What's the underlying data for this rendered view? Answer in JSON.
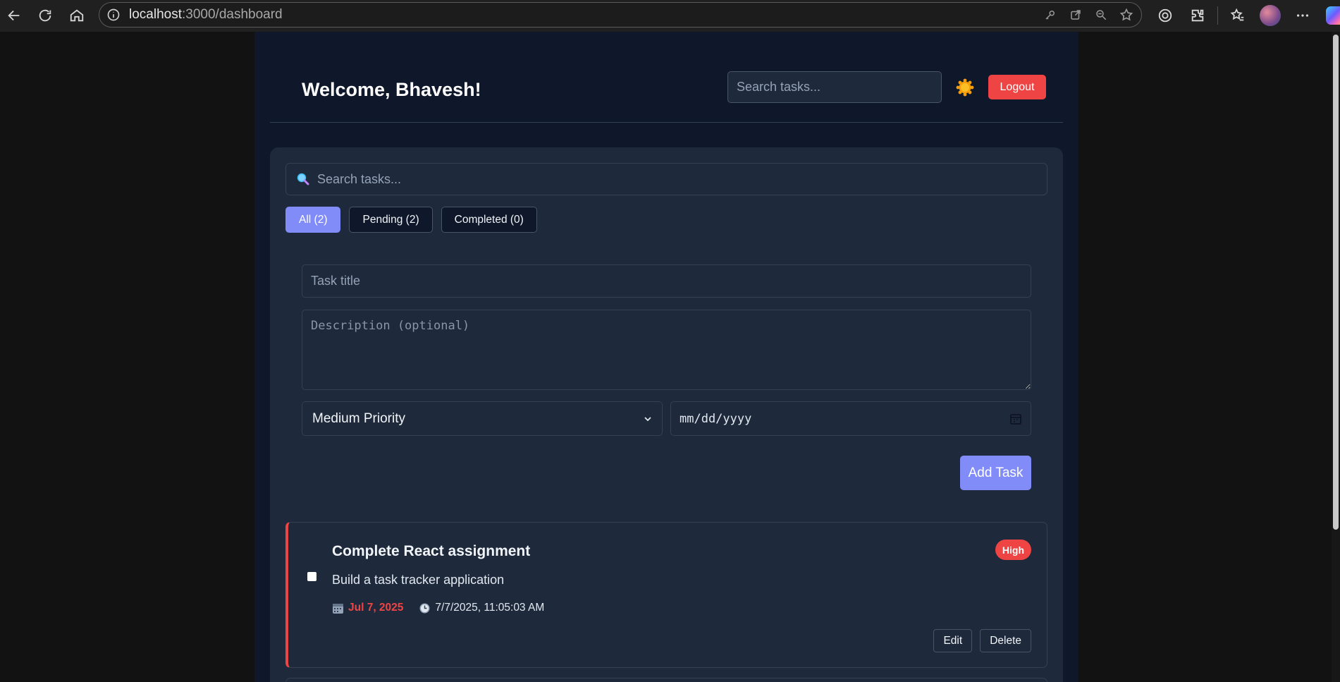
{
  "browser": {
    "url_host": "localhost",
    "url_path": ":3000/dashboard"
  },
  "header": {
    "welcome": "Welcome, Bhavesh!",
    "search_placeholder": "Search tasks...",
    "theme_icon": "sun-icon",
    "logout_label": "Logout"
  },
  "panel": {
    "search_placeholder": "Search tasks...",
    "filters": [
      {
        "label": "All (2)",
        "active": true
      },
      {
        "label": "Pending (2)",
        "active": false
      },
      {
        "label": "Completed (0)",
        "active": false
      }
    ]
  },
  "form": {
    "title_placeholder": "Task title",
    "description_placeholder": "Description (optional)",
    "priority_value": "Medium Priority",
    "date_placeholder": "mm/dd/yyyy",
    "add_label": "Add Task"
  },
  "tasks": [
    {
      "title": "Complete React assignment",
      "description": "Build a task tracker application",
      "priority": "High",
      "priority_color": "#ef4444",
      "due_date": "Jul 7, 2025",
      "created_at": "7/7/2025, 11:05:03 AM",
      "completed": false,
      "edit_label": "Edit",
      "delete_label": "Delete"
    }
  ],
  "colors": {
    "accent": "#818cf8",
    "danger": "#ef4444",
    "background": "#0f172a",
    "panel": "#1e293b"
  }
}
